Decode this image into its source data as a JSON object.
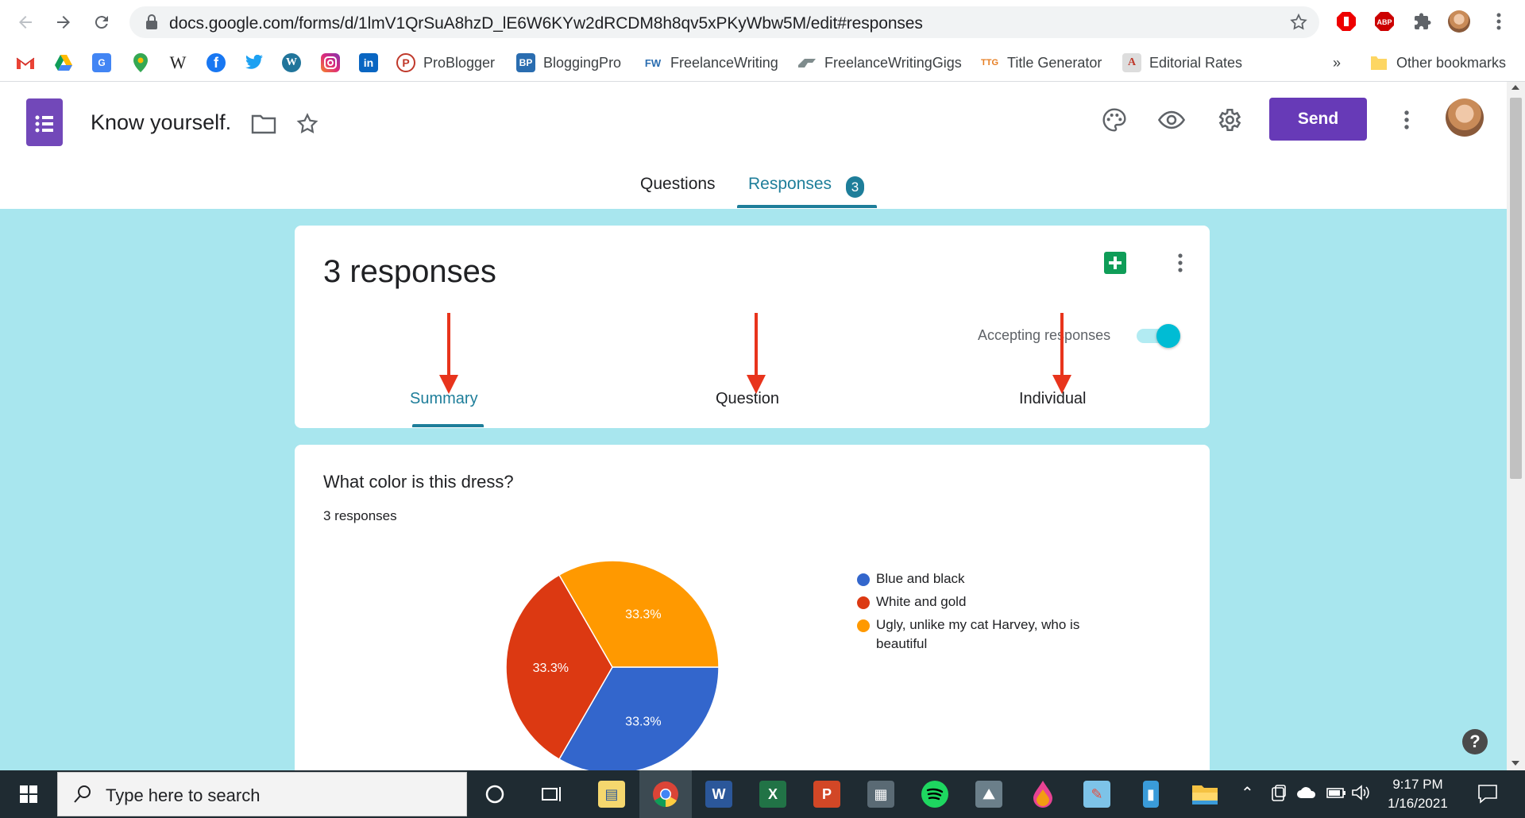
{
  "browser": {
    "url": "docs.google.com/forms/d/1lmV1QrSuA8hzD_lE6W6KYw2dRCDM8h8qv5xPKyWbw5M/edit#responses",
    "bookmarks": [
      {
        "label": "",
        "icon": "gmail-icon"
      },
      {
        "label": "",
        "icon": "drive-icon"
      },
      {
        "label": "",
        "icon": "translate-icon"
      },
      {
        "label": "",
        "icon": "maps-icon"
      },
      {
        "label": "",
        "icon": "wikipedia-icon"
      },
      {
        "label": "",
        "icon": "facebook-icon"
      },
      {
        "label": "",
        "icon": "twitter-icon"
      },
      {
        "label": "",
        "icon": "wordpress-icon"
      },
      {
        "label": "",
        "icon": "instagram-icon"
      },
      {
        "label": "",
        "icon": "linkedin-icon"
      },
      {
        "label": "ProBlogger",
        "icon": "problogger-icon"
      },
      {
        "label": "BloggingPro",
        "icon": "bloggingpro-icon"
      },
      {
        "label": "FreelanceWriting",
        "icon": "fw-icon"
      },
      {
        "label": "FreelanceWritingGigs",
        "icon": "fwg-icon"
      },
      {
        "label": "Title Generator",
        "icon": "title-generator-icon"
      },
      {
        "label": "Editorial Rates",
        "icon": "editorial-rates-icon"
      }
    ],
    "bookmarks_overflow": "»",
    "other_bookmarks": "Other bookmarks"
  },
  "form": {
    "title": "Know yourself.",
    "send_label": "Send",
    "tabs": {
      "questions": "Questions",
      "responses": "Responses",
      "responses_count": "3"
    }
  },
  "summary_card": {
    "count_label": "3 responses",
    "accepting_label": "Accepting responses",
    "subtabs": {
      "summary": "Summary",
      "question": "Question",
      "individual": "Individual"
    }
  },
  "question_card": {
    "title": "What color is this dress?",
    "count_label": "3 responses"
  },
  "chart_data": {
    "type": "pie",
    "categories": [
      "Blue and black",
      "White and gold",
      "Ugly, unlike my cat Harvey, who is beautiful"
    ],
    "values": [
      33.3,
      33.3,
      33.3
    ],
    "labels": [
      "33.3%",
      "33.3%",
      "33.3%"
    ],
    "colors": [
      "#3366cc",
      "#dc3912",
      "#ff9900"
    ],
    "legend_position": "right",
    "legend_lines": [
      [
        "Blue and black"
      ],
      [
        "White and gold"
      ],
      [
        "Ugly, unlike my cat Harvey, who is",
        "beautiful"
      ]
    ]
  },
  "taskbar": {
    "search_placeholder": "Type here to search",
    "time": "9:17 PM",
    "date": "1/16/2021"
  },
  "colors": {
    "accent": "#1e7e9a",
    "send": "#673ab7",
    "background": "#a8e6ee"
  }
}
